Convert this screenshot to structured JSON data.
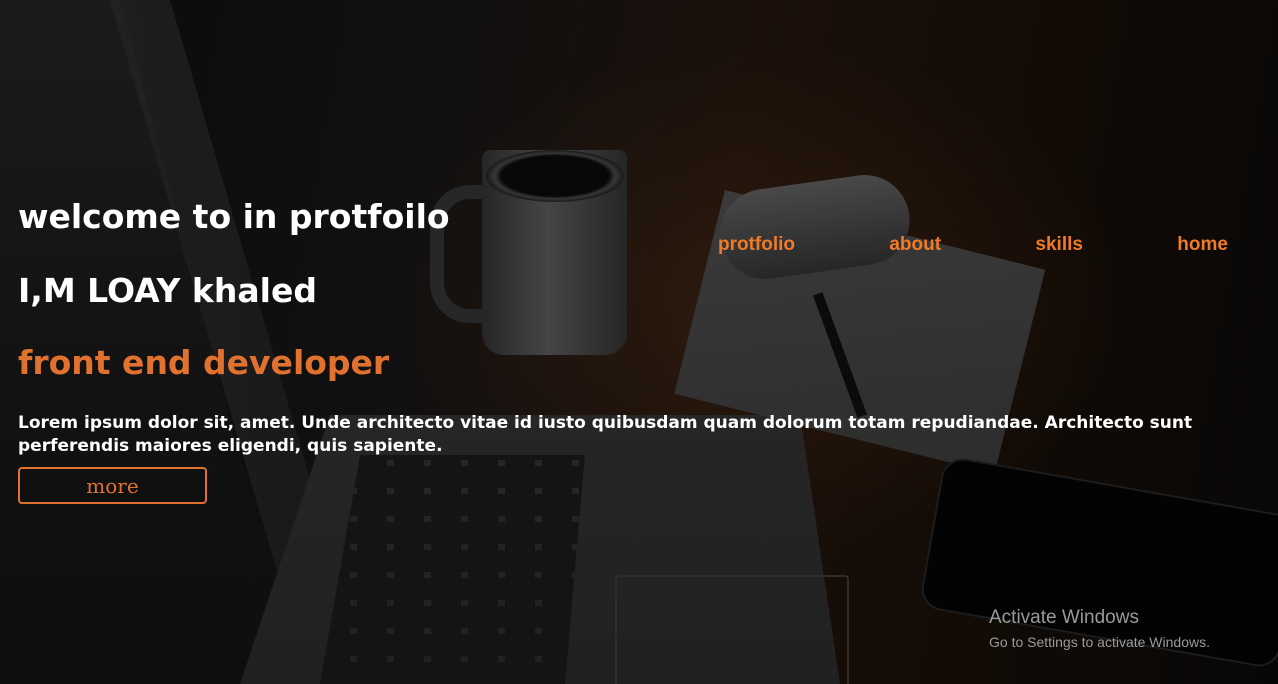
{
  "nav": {
    "items": [
      {
        "label": "protfolio"
      },
      {
        "label": "about"
      },
      {
        "label": "skills"
      },
      {
        "label": "home"
      }
    ]
  },
  "hero": {
    "welcome": "welcome to in protfoilo",
    "name": "I,M LOAY khaled",
    "role": "front end developer",
    "intro": "Lorem ipsum dolor sit, amet. Unde architecto vitae id iusto quibusdam quam dolorum totam repudiandae. Architecto sunt perferendis maiores eligendi, quis sapiente.",
    "more_label": "more"
  },
  "watermark": {
    "title": "Activate Windows",
    "subtitle": "Go to Settings to activate Windows."
  },
  "colors": {
    "accent": "#e0712e",
    "nav": "#f07a25",
    "text": "#ffffff"
  }
}
